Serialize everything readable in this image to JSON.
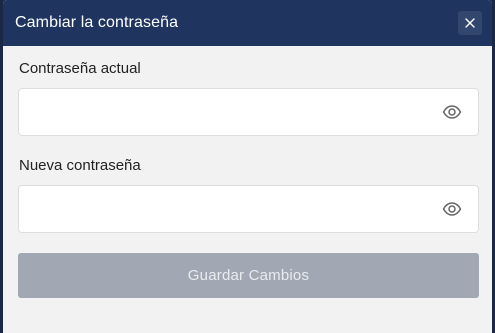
{
  "dialog": {
    "title": "Cambiar la contraseña",
    "close_icon": "close-icon"
  },
  "fields": [
    {
      "label": "Contraseña actual",
      "value": "",
      "placeholder": "",
      "type": "password",
      "toggle_icon": "eye-icon"
    },
    {
      "label": "Nueva contraseña",
      "value": "",
      "placeholder": "",
      "type": "password",
      "toggle_icon": "eye-icon"
    }
  ],
  "submit": {
    "label": "Guardar Cambios",
    "state": "disabled"
  },
  "colors": {
    "header": "#1f3560",
    "body": "#f2f2f2",
    "button_disabled": "#a2a8b3"
  }
}
